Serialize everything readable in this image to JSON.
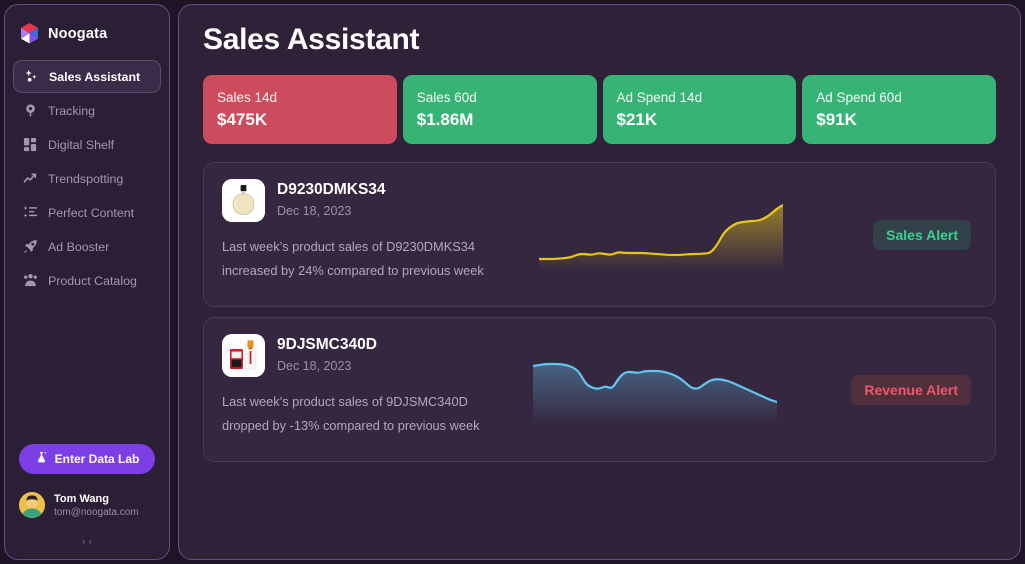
{
  "brand": {
    "name": "Noogata",
    "logo_icon": "noogata-hexagon-logo"
  },
  "sidebar": {
    "items": [
      {
        "label": "Sales Assistant",
        "icon": "sparkle-icon",
        "active": true
      },
      {
        "label": "Tracking",
        "icon": "location-pin-icon",
        "active": false
      },
      {
        "label": "Digital Shelf",
        "icon": "grid-icon",
        "active": false
      },
      {
        "label": "Trendspotting",
        "icon": "trend-arrow-icon",
        "active": false
      },
      {
        "label": "Perfect Content",
        "icon": "list-icon",
        "active": false
      },
      {
        "label": "Ad Booster",
        "icon": "rocket-icon",
        "active": false
      },
      {
        "label": "Product Catalog",
        "icon": "group-icon",
        "active": false
      }
    ],
    "data_lab_button": {
      "label": "Enter Data Lab",
      "icon": "flask-icon",
      "color": "#7b3fe4"
    },
    "user": {
      "name": "Tom Wang",
      "email": "tom@noogata.com",
      "avatar_icon": "user-avatar"
    },
    "collapse": {
      "label": "› ‹",
      "icon": "collapse-sidebar-icon"
    }
  },
  "header": {
    "title": "Sales Assistant"
  },
  "kpis": [
    {
      "label": "Sales 14d",
      "value": "$475K",
      "color": "#cc4b5c"
    },
    {
      "label": "Sales 60d",
      "value": "$1.86M",
      "color": "#37b376"
    },
    {
      "label": "Ad Spend 14d",
      "value": "$21K",
      "color": "#37b376"
    },
    {
      "label": "Ad Spend 60d",
      "value": "$91K",
      "color": "#37b376"
    }
  ],
  "alerts": [
    {
      "sku": "D9230DMKS34",
      "date": "Dec 18, 2023",
      "description_line1": "Last week’s product sales of D9230DMKS34",
      "description_line2": "increased by 24% compared to previous week",
      "badge": {
        "label": "Sales Alert",
        "color": "#3ecf8e",
        "background": "#32404a"
      },
      "thumbnail_icon": "perfume-bottle-product-image",
      "chart_data": {
        "type": "area",
        "title": "",
        "color": "#e8c41e",
        "trend": "increase",
        "values": [
          8,
          8,
          8,
          8.5,
          9,
          10,
          13,
          13,
          12,
          14,
          13,
          12,
          15,
          14,
          14,
          14,
          14,
          13.5,
          13,
          12.5,
          12,
          12,
          12.5,
          13,
          13,
          13.5,
          14,
          22,
          34,
          40,
          44,
          45,
          46,
          46,
          48,
          52,
          58,
          62
        ],
        "ylim": [
          0,
          70
        ],
        "grid": false
      }
    },
    {
      "sku": "9DJSMC340D",
      "date": "Dec 18, 2023",
      "description_line1": "Last week’s product sales of 9DJSMC340D",
      "description_line2": "dropped by -13% compared to previous week",
      "badge": {
        "label": "Revenue Alert",
        "color": "#f0556b",
        "background": "#50303c"
      },
      "thumbnail_icon": "serum-bottle-product-image",
      "chart_data": {
        "type": "area",
        "title": "",
        "color": "#63c6ef",
        "trend": "decrease",
        "values": [
          56,
          57,
          58,
          58,
          58,
          57,
          55,
          50,
          38,
          34,
          33,
          36,
          33,
          44,
          50,
          50,
          49,
          51,
          51,
          51,
          50,
          48,
          45,
          40,
          34,
          33,
          38,
          42,
          43,
          42,
          40,
          37,
          34,
          31,
          28,
          25,
          22,
          20
        ],
        "ylim": [
          0,
          70
        ],
        "grid": false
      }
    }
  ]
}
